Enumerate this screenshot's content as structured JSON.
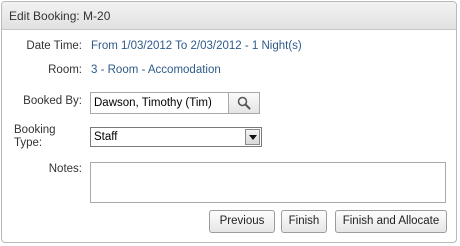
{
  "title": "Edit Booking: M-20",
  "fields": {
    "date_time": {
      "label": "Date Time:",
      "value": "From 1/03/2012 To 2/03/2012 - 1 Night(s)"
    },
    "room": {
      "label": "Room:",
      "value": "3 - Room - Accomodation"
    },
    "booked_by": {
      "label": "Booked By:",
      "value": "Dawson, Timothy (Tim)"
    },
    "booking_type": {
      "label_line1": "Booking",
      "label_line2": "Type:",
      "value": "Staff"
    },
    "notes": {
      "label": "Notes:",
      "value": ""
    }
  },
  "buttons": {
    "previous": "Previous",
    "finish": "Finish",
    "finish_allocate": "Finish and Allocate"
  },
  "icons": {
    "search": "search-icon",
    "dropdown": "chevron-down-icon"
  },
  "colors": {
    "link_text": "#2e5a8a",
    "title_bg": "#e6e6e6"
  }
}
